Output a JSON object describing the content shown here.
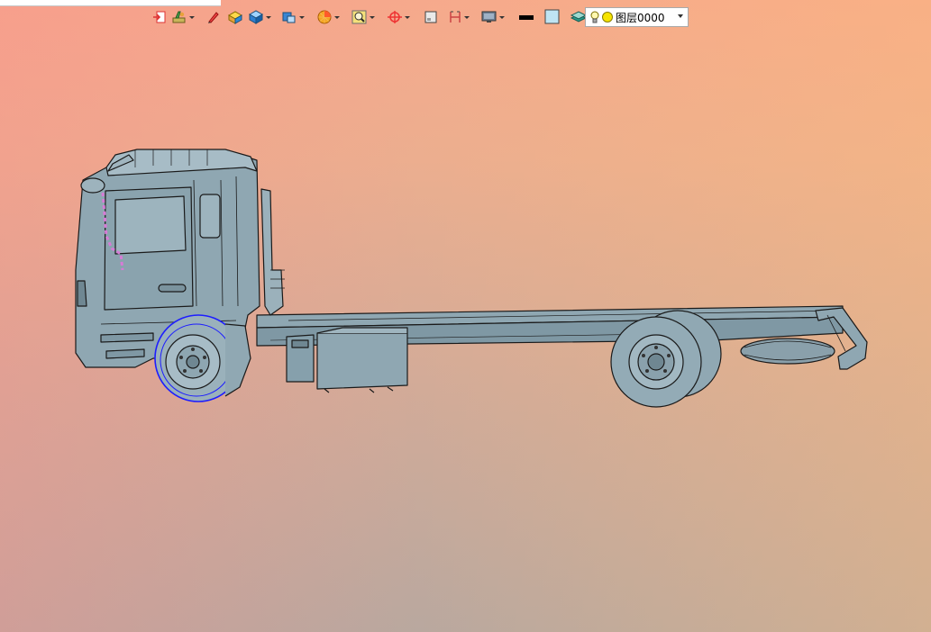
{
  "window": {
    "title": ""
  },
  "toolbar": {
    "buttons": [
      {
        "name": "exit-sketch-icon",
        "has_dropdown": false
      },
      {
        "name": "sketch-tools-icon",
        "has_dropdown": true
      },
      {
        "name": "pencil-icon",
        "has_dropdown": false
      },
      {
        "name": "box-solid-icon",
        "has_dropdown": false
      },
      {
        "name": "cube-shaded-icon",
        "has_dropdown": true
      },
      {
        "name": "view-orient-icon",
        "has_dropdown": true
      },
      {
        "name": "render-style-icon",
        "has_dropdown": true
      },
      {
        "name": "zoom-fit-icon",
        "has_dropdown": true
      },
      {
        "name": "origin-axis-icon",
        "has_dropdown": true
      },
      {
        "name": "frame-icon",
        "has_dropdown": false
      },
      {
        "name": "dimension-icon",
        "has_dropdown": true
      },
      {
        "name": "monitor-view-icon",
        "has_dropdown": true
      },
      {
        "name": "line-color-swatch",
        "has_dropdown": false
      },
      {
        "name": "fill-color-swatch",
        "has_dropdown": false
      },
      {
        "name": "layers-icon",
        "has_dropdown": true
      }
    ],
    "line_color": "#000000",
    "fill_color": "#bfe4f3"
  },
  "layer": {
    "selected": "图层0000",
    "bulb_icon": "lightbulb-icon",
    "color": "#f6e400"
  },
  "model": {
    "body_color": "#8fa7b2",
    "edge_color": "#1a1a1a",
    "selected_wheel_color": "#1d1dff",
    "highlight_color": "#d77bd6"
  }
}
